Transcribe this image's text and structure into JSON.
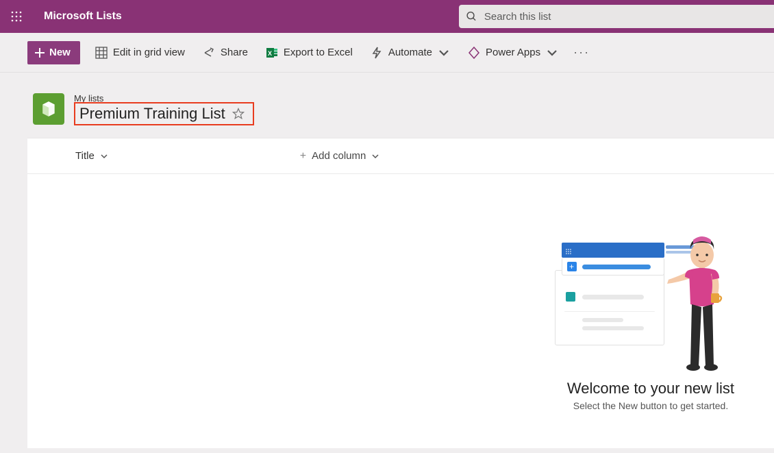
{
  "header": {
    "app_title": "Microsoft Lists",
    "search_placeholder": "Search this list"
  },
  "commands": {
    "new": "New",
    "edit_grid": "Edit in grid view",
    "share": "Share",
    "export": "Export to Excel",
    "automate": "Automate",
    "powerapps": "Power Apps"
  },
  "list": {
    "parent": "My lists",
    "title": "Premium Training List"
  },
  "columns": {
    "title": "Title",
    "add": "Add column"
  },
  "empty": {
    "heading": "Welcome to your new list",
    "sub": "Select the New button to get started."
  },
  "colors": {
    "brand": "#893275",
    "accent_green": "#5c9e31",
    "highlight_red": "#e83b1e"
  }
}
